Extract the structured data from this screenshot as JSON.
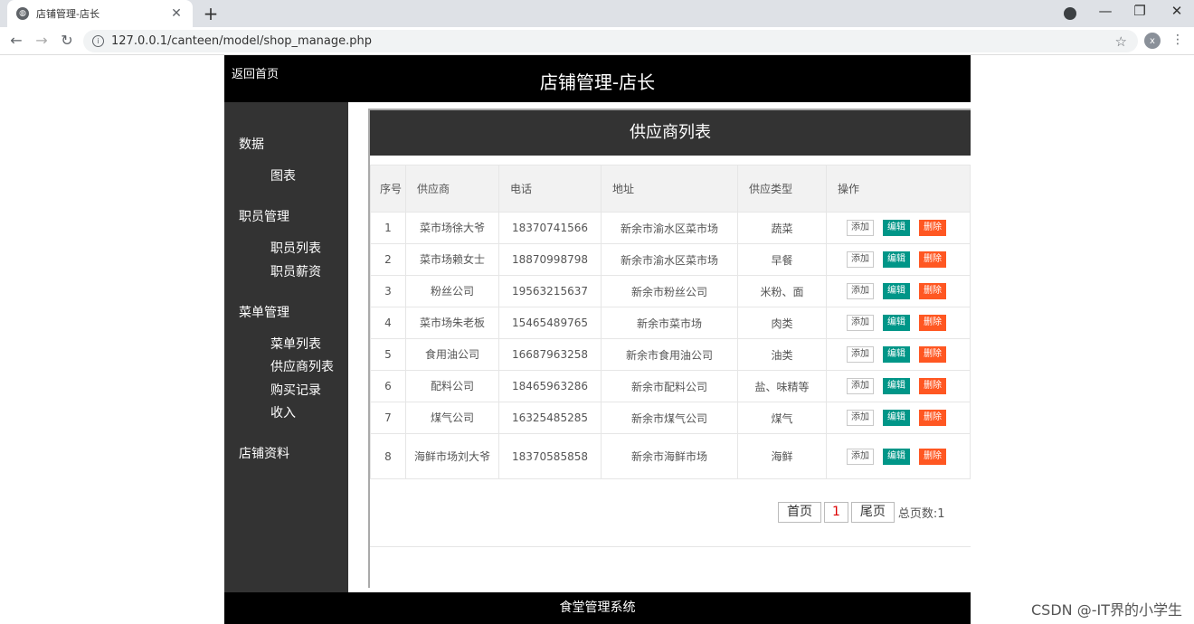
{
  "browser": {
    "tab_title": "店铺管理-店长",
    "url": "127.0.0.1/canteen/model/shop_manage.php",
    "profile_initial": "x"
  },
  "header": {
    "back_link": "返回首页",
    "title": "店铺管理-店长"
  },
  "sidebar": {
    "groups": [
      {
        "label": "数据",
        "items": [
          {
            "label": "图表"
          }
        ]
      },
      {
        "label": "职员管理",
        "items": [
          {
            "label": "职员列表"
          },
          {
            "label": "职员薪资"
          }
        ]
      },
      {
        "label": "菜单管理",
        "items": [
          {
            "label": "菜单列表"
          },
          {
            "label": "供应商列表"
          },
          {
            "label": "购买记录"
          },
          {
            "label": "收入"
          }
        ]
      },
      {
        "label": "店铺资料",
        "items": []
      }
    ]
  },
  "panel": {
    "title": "供应商列表",
    "columns": [
      "序号",
      "供应商",
      "电话",
      "地址",
      "供应类型",
      "操作"
    ],
    "actions": {
      "add": "添加",
      "edit": "编辑",
      "delete": "删除"
    },
    "rows": [
      {
        "no": "1",
        "supplier": "菜市场徐大爷",
        "phone": "18370741566",
        "address": "新余市渝水区菜市场",
        "type": "蔬菜"
      },
      {
        "no": "2",
        "supplier": "菜市场赖女士",
        "phone": "18870998798",
        "address": "新余市渝水区菜市场",
        "type": "早餐"
      },
      {
        "no": "3",
        "supplier": "粉丝公司",
        "phone": "19563215637",
        "address": "新余市粉丝公司",
        "type": "米粉、面"
      },
      {
        "no": "4",
        "supplier": "菜市场朱老板",
        "phone": "15465489765",
        "address": "新余市菜市场",
        "type": "肉类"
      },
      {
        "no": "5",
        "supplier": "食用油公司",
        "phone": "16687963258",
        "address": "新余市食用油公司",
        "type": "油类"
      },
      {
        "no": "6",
        "supplier": "配料公司",
        "phone": "18465963286",
        "address": "新余市配料公司",
        "type": "盐、味精等"
      },
      {
        "no": "7",
        "supplier": "煤气公司",
        "phone": "16325485285",
        "address": "新余市煤气公司",
        "type": "煤气"
      },
      {
        "no": "8",
        "supplier": "海鲜市场刘大爷",
        "phone": "18370585858",
        "address": "新余市海鲜市场",
        "type": "海鲜"
      }
    ],
    "pager": {
      "first": "首页",
      "current": "1",
      "last": "尾页",
      "total": "总页数:1"
    }
  },
  "footer": {
    "text": "食堂管理系统"
  },
  "watermark": "CSDN @-IT界的小学生"
}
